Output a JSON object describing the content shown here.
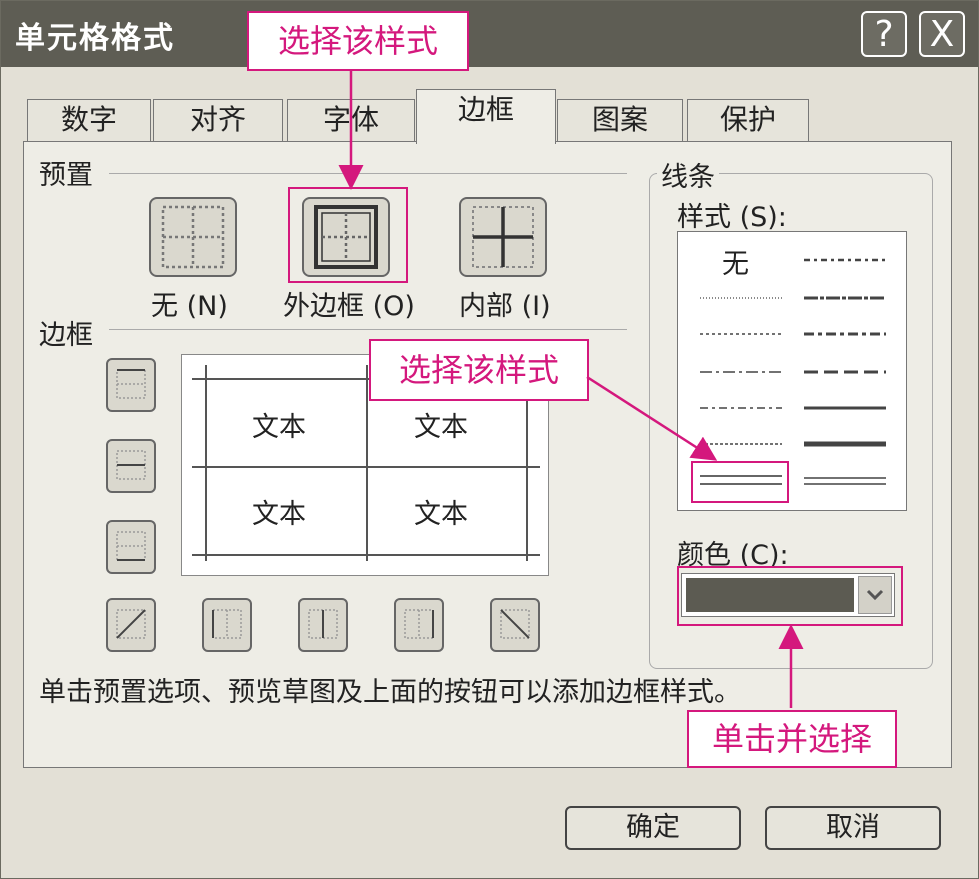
{
  "dialog": {
    "title": "单元格格式",
    "help_label": "?",
    "close_label": "X"
  },
  "tabs": [
    "数字",
    "对齐",
    "字体",
    "边框",
    "图案",
    "保护"
  ],
  "active_tab": "边框",
  "presets": {
    "section_label": "预置",
    "items": [
      {
        "label": "无 (N)"
      },
      {
        "label": "外边框 (O)"
      },
      {
        "label": "内部 (I)"
      }
    ]
  },
  "border": {
    "section_label": "边框",
    "preview_cells": [
      "文本",
      "文本",
      "文本",
      "文本"
    ]
  },
  "lines": {
    "group_label": "线条",
    "style_label": "样式 (S):",
    "none_label": "无",
    "color_label": "颜色 (C):",
    "color_value": "#5c5b52"
  },
  "hint": "单击预置选项、预览草图及上面的按钮可以添加边框样式。",
  "buttons": {
    "ok": "确定",
    "cancel": "取消"
  },
  "annotations": {
    "callout_top": "选择该样式",
    "callout_middle": "选择该样式",
    "callout_bottom": "单击并选择",
    "accent_color": "#d4187d"
  }
}
